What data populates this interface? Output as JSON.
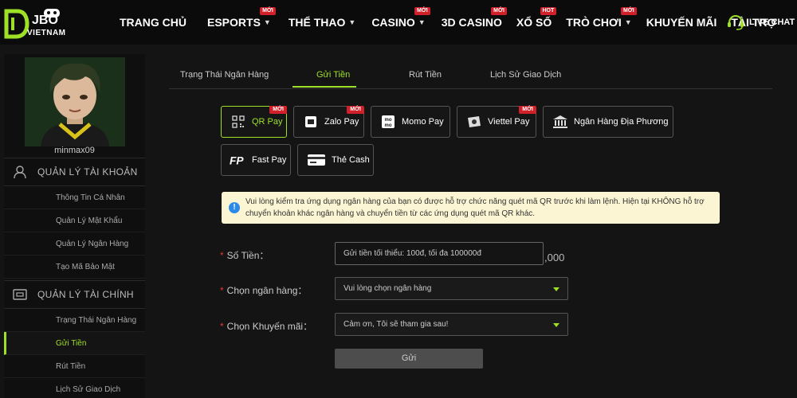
{
  "brand": {
    "name": "JBO",
    "sub": "VIETNAM"
  },
  "nav": [
    {
      "label": "TRANG CHỦ",
      "caret": false,
      "badge": ""
    },
    {
      "label": "ESPORTS",
      "caret": true,
      "badge": "MỚI"
    },
    {
      "label": "THỂ THAO",
      "caret": true,
      "badge": ""
    },
    {
      "label": "CASINO",
      "caret": true,
      "badge": "MỚI"
    },
    {
      "label": "3D CASINO",
      "caret": false,
      "badge": "MỚI"
    },
    {
      "label": "XỔ SỐ",
      "caret": false,
      "badge": "HOT"
    },
    {
      "label": "TRÒ CHƠI",
      "caret": true,
      "badge": "MỚI"
    },
    {
      "label": "KHUYẾN MÃI",
      "caret": false,
      "badge": ""
    },
    {
      "label": "TÀI TRỢ",
      "caret": false,
      "badge": ""
    }
  ],
  "live_chat": "LIVE CHAT",
  "sidebar": {
    "username": "minmax09",
    "account_section": "QUẢN LÝ TÀI KHOẢN",
    "account_items": [
      "Thông Tin Cá Nhân",
      "Quản Lý Mật Khẩu",
      "Quản Lý Ngân Hàng",
      "Tạo Mã Bảo Mật"
    ],
    "finance_section": "QUẢN LÝ TÀI CHÍNH",
    "finance_items": [
      "Trạng Thái Ngân Hàng",
      "Gửi Tiền",
      "Rút Tiền",
      "Lịch Sử Giao Dịch"
    ],
    "active_item": "Gửi Tiền"
  },
  "tabs": [
    "Trạng Thái Ngân Hàng",
    "Gửi Tiền",
    "Rút Tiền",
    "Lịch Sử Giao Dịch"
  ],
  "active_tab": "Gửi Tiền",
  "payment_methods": [
    {
      "label": "QR Pay",
      "badge": "MỚI",
      "icon": "qr-icon",
      "active": true
    },
    {
      "label": "Zalo Pay",
      "badge": "MỚI",
      "icon": "zalo-pay-icon",
      "active": false
    },
    {
      "label": "Momo Pay",
      "badge": "",
      "icon": "momo-icon",
      "active": false
    },
    {
      "label": "Viettel Pay",
      "badge": "MỚI",
      "icon": "viettel-pay-icon",
      "active": false
    },
    {
      "label": "Ngân Hàng Địa Phương",
      "badge": "",
      "icon": "bank-icon",
      "active": false
    },
    {
      "label": "Fast Pay",
      "badge": "",
      "icon": "fast-pay-icon",
      "active": false
    },
    {
      "label": "Thẻ Cash",
      "badge": "",
      "icon": "card-icon",
      "active": false
    }
  ],
  "notice": "Vui lòng kiểm tra ứng dụng ngân hàng của bạn có được hỗ trợ chức năng quét mã QR trước khi làm lệnh. Hiện tại KHÔNG hỗ trợ chuyển khoản khác ngân hàng và chuyển tiền từ các ứng dụng quét mã QR khác.",
  "form": {
    "amount_label": "Số Tiền：",
    "amount_placeholder": "Gửi tiền tối thiểu: 100đ, tối đa 100000đ",
    "amount_suffix": ",000",
    "bank_label": "Chọn ngân hàng：",
    "bank_value": "Vui lòng chọn ngân hàng",
    "promo_label": "Chọn Khuyến mãi：",
    "promo_value": "Cảm ơn, Tôi sẽ tham gia sau!",
    "submit": "Gửi"
  },
  "colors": {
    "accent": "#9ee026",
    "badge": "#d0202a",
    "notice_bg": "#fbf5d3",
    "info": "#2c8be8"
  }
}
